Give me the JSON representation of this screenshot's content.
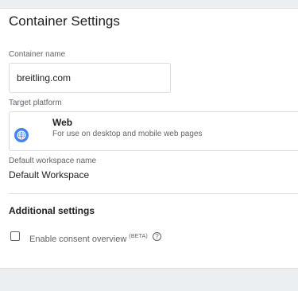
{
  "page": {
    "title": "Container Settings"
  },
  "container_name": {
    "label": "Container name",
    "value": "breitling.com"
  },
  "target_platform": {
    "label": "Target platform",
    "icon": "globe-icon",
    "name": "Web",
    "description": "For use on desktop and mobile web pages",
    "accent_color": "#4285f4"
  },
  "default_workspace": {
    "label": "Default workspace name",
    "value": "Default Workspace"
  },
  "additional_settings": {
    "heading": "Additional settings",
    "consent_overview": {
      "label": "Enable consent overview",
      "badge": "(BETA)",
      "checked": false,
      "help_icon": "help-circle-icon",
      "help_glyph": "?"
    }
  }
}
